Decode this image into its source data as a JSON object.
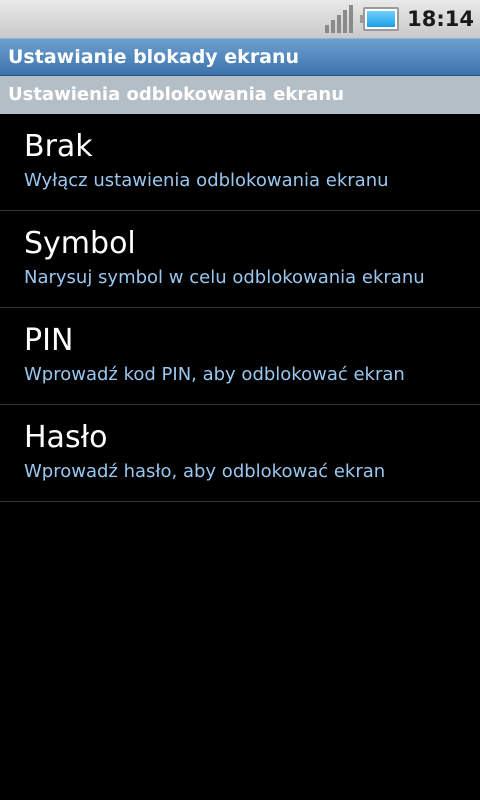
{
  "status_bar": {
    "time": "18:14",
    "signal_icon": "signal-bars-icon",
    "battery_icon": "battery-icon",
    "battery_level": 1.0,
    "battery_color": "#2aa8f0"
  },
  "title_bar": {
    "title": "Ustawianie blokady ekranu",
    "color": "#4a82bd"
  },
  "section": {
    "header": "Ustawienia odblokowania ekranu"
  },
  "options": [
    {
      "title": "Brak",
      "subtitle": "Wyłącz ustawienia odblokowania ekranu"
    },
    {
      "title": "Symbol",
      "subtitle": "Narysuj symbol w celu odblokowania ekranu"
    },
    {
      "title": "PIN",
      "subtitle": "Wprowadź kod PIN, aby odblokować ekran"
    },
    {
      "title": "Hasło",
      "subtitle": "Wprowadź hasło, aby odblokować ekran"
    }
  ],
  "colors": {
    "background": "#000000",
    "subtitle": "#99c7ef",
    "section_header": "#b4bec6"
  }
}
